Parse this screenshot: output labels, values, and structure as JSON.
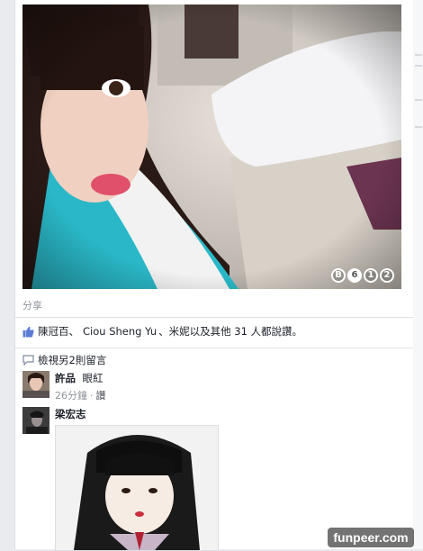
{
  "post": {
    "photo": {
      "counter": [
        "B",
        "6",
        "1",
        "2"
      ]
    },
    "share_label": "分享",
    "likes": {
      "name1": "陳冠百",
      "sep1": "、",
      "name2": "Ciou Sheng Yu",
      "sep2": "、",
      "name3": "米妮",
      "suffix": "以及其他 31 人都說讚。"
    },
    "more_comments_label": "檢視另2則留言",
    "comments": [
      {
        "author": "許品",
        "text": "眼紅",
        "time": "26分鐘",
        "dot": "·",
        "like_label": "讚"
      },
      {
        "author": "梁宏志"
      }
    ]
  },
  "watermark": "funpeer.com",
  "colors": {
    "link": "#1d2129",
    "meta": "#90949c",
    "background": "#e9ebee",
    "like_blue": "#5b7bd5"
  }
}
